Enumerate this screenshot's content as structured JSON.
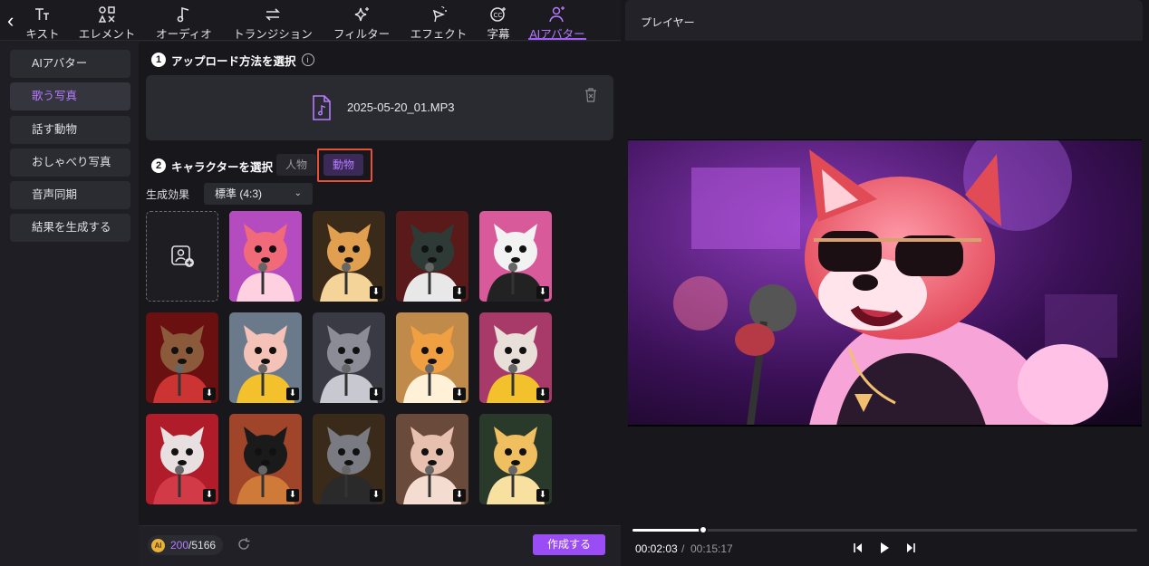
{
  "toolbar": {
    "tabs": [
      {
        "label": "キスト",
        "icon": "text-icon"
      },
      {
        "label": "エレメント",
        "icon": "elements-icon"
      },
      {
        "label": "オーディオ",
        "icon": "music-note-icon"
      },
      {
        "label": "トランジション",
        "icon": "transition-arrows-icon"
      },
      {
        "label": "フィルター",
        "icon": "sparkle-icon"
      },
      {
        "label": "エフェクト",
        "icon": "effect-icon"
      },
      {
        "label": "字幕",
        "icon": "caption-icon"
      },
      {
        "label": "AIアバター",
        "icon": "ai-avatar-icon"
      }
    ],
    "active_tab": "AIアバター"
  },
  "sidenav": {
    "items": [
      {
        "label": "AIアバター"
      },
      {
        "label": "歌う写真"
      },
      {
        "label": "話す動物"
      },
      {
        "label": "おしゃべり写真"
      },
      {
        "label": "音声同期"
      },
      {
        "label": "結果を生成する"
      }
    ],
    "active": "歌う写真"
  },
  "step1": {
    "num": "1",
    "title": "アップロード方法を選択",
    "info": "i"
  },
  "upload": {
    "file_name": "2025-05-20_01.MP3"
  },
  "step2": {
    "num": "2",
    "title": "キャラクターを選択"
  },
  "character_tabs": {
    "people": "人物",
    "animal": "動物",
    "selected": "動物"
  },
  "effect": {
    "label": "生成効果",
    "value": "標準 (4:3)"
  },
  "characters": [
    "red-fox-sunglasses",
    "cat-singer",
    "black-white-cat",
    "panda-suit",
    "dog-sunglasses-red",
    "pig-yellow-jacket",
    "grey-bear",
    "shiba-dog",
    "white-dog-sunglasses",
    "white-sheep-red",
    "black-cat-sunglasses",
    "grey-mouse",
    "bunny-singer",
    "yellow-cat"
  ],
  "footer": {
    "credits_used": "200",
    "credits_total": "/5166",
    "ai_badge": "AI",
    "create_label": "作成する"
  },
  "player": {
    "title": "プレイヤー",
    "time_current": "00:02:03",
    "time_sep": "/",
    "time_total": "00:15:17",
    "progress": 0.14
  },
  "colors": {
    "accent": "#9a4cf5",
    "accent_text": "#b57bff",
    "highlight": "#e8503a"
  }
}
